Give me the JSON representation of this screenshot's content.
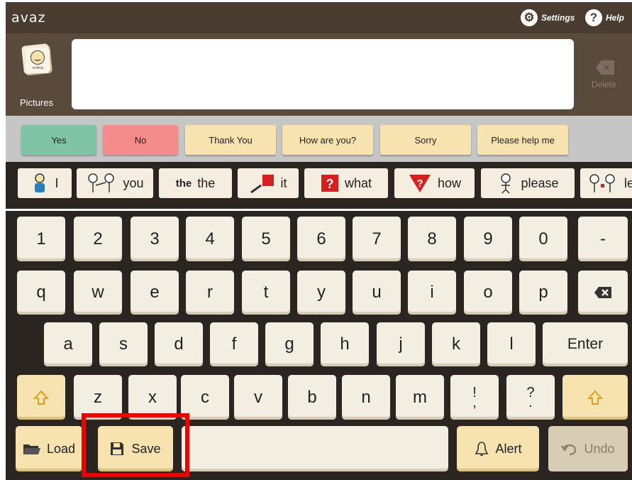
{
  "app": {
    "logo": "avaz",
    "settings_label": "Settings",
    "help_label": "Help"
  },
  "message": {
    "pictures_label": "Pictures",
    "pictures_card_caption": "smiling",
    "text": "",
    "delete_label": "Delete"
  },
  "quick_phrases": [
    {
      "label": "Yes",
      "color": "#7fc4a4"
    },
    {
      "label": "No",
      "color": "#f58c8c"
    },
    {
      "label": "Thank You",
      "color": "#f7e3b0"
    },
    {
      "label": "How are you?",
      "color": "#f7e3b0"
    },
    {
      "label": "Sorry",
      "color": "#f7e3b0"
    },
    {
      "label": "Please help me",
      "color": "#f7e3b0"
    }
  ],
  "word_predictions": [
    {
      "label": "I",
      "icon": "person-icon"
    },
    {
      "label": "you",
      "icon": "pointing-person-icon"
    },
    {
      "label": "the",
      "icon": "the-text-icon",
      "icon_text": "the"
    },
    {
      "label": "it",
      "icon": "pointing-hand-icon"
    },
    {
      "label": "what",
      "icon": "question-mark-icon"
    },
    {
      "label": "how",
      "icon": "question-triangle-icon"
    },
    {
      "label": "please",
      "icon": "please-person-icon"
    },
    {
      "label": "le",
      "icon": "two-people-icon"
    }
  ],
  "keyboard": {
    "row1": [
      "1",
      "2",
      "3",
      "4",
      "5",
      "6",
      "7",
      "8",
      "9",
      "0",
      "-"
    ],
    "row2": [
      "q",
      "w",
      "e",
      "r",
      "t",
      "y",
      "u",
      "i",
      "o",
      "p"
    ],
    "row3": [
      "a",
      "s",
      "d",
      "f",
      "g",
      "h",
      "j",
      "k",
      "l"
    ],
    "enter_label": "Enter",
    "row4": [
      "z",
      "x",
      "c",
      "v",
      "b",
      "n",
      "m"
    ],
    "punct1": {
      "top": "!",
      "bottom": ","
    },
    "punct2": {
      "top": "?",
      "bottom": "."
    },
    "load_label": "Load",
    "save_label": "Save",
    "space_value": "",
    "alert_label": "Alert",
    "undo_label": "Undo"
  },
  "colors": {
    "key": "#f3eee2",
    "accent_key": "#f7e3b0",
    "highlight": "#ee0000"
  }
}
